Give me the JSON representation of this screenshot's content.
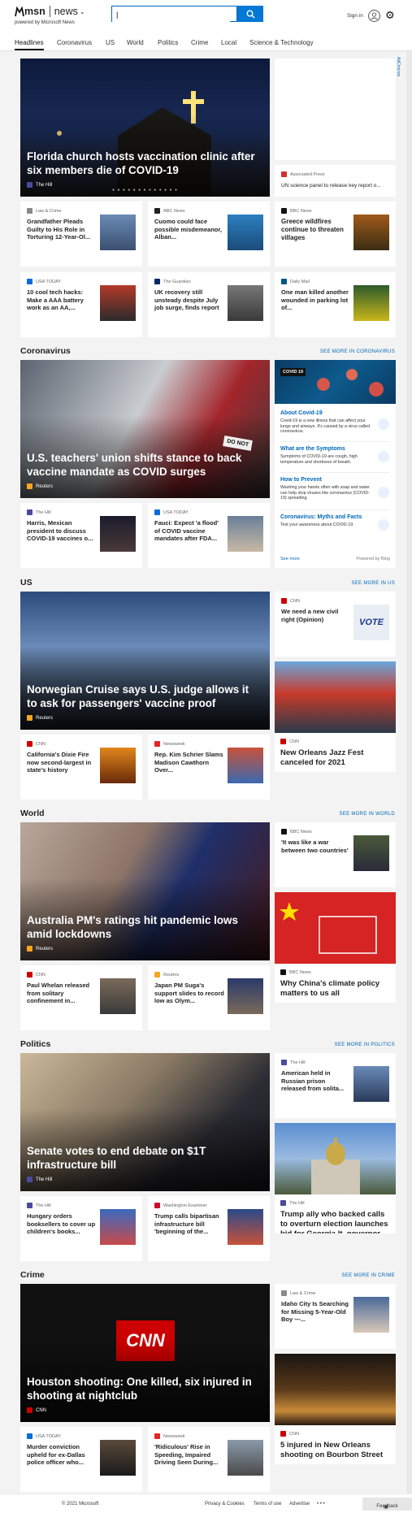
{
  "header": {
    "brand": "msn",
    "section": "news",
    "chevron": "⌄",
    "powered_by": "powered by Microsoft News",
    "search_value": "|",
    "signin": "Sign in"
  },
  "nav": [
    "Headlines",
    "Coronavirus",
    "US",
    "World",
    "Politics",
    "Crime",
    "Local",
    "Science & Technology"
  ],
  "ad_choices": "AdChoices",
  "headlines": {
    "hero": {
      "title": "Florida church hosts vaccination clinic after six members die of COVID-19",
      "source": "The Hill",
      "dots": "● ● ● ● ● ● ● ● ● ● ● ● ●"
    },
    "ap": {
      "source": "Associated Press",
      "title": "UN science panel to release key report o..."
    },
    "row1": [
      {
        "source": "Law & Crime",
        "title": "Grandfather Pleads Guilty to His Role in Torturing 12-Year-Ol..."
      },
      {
        "source": "ABC News",
        "title": "Cuomo could face possible misdemeanor, Alban..."
      },
      {
        "source": "BBC News",
        "title": "Greece wildfires continue to threaten villages"
      }
    ],
    "row2": [
      {
        "source": "USA TODAY",
        "title": "10 cool tech hacks: Make a AAA battery work as an AA,..."
      },
      {
        "source": "The Guardian",
        "title": "UK recovery still unsteady despite July job surge, finds report"
      },
      {
        "source": "Daily Mail",
        "title": "One man killed another wounded in parking lot of..."
      }
    ]
  },
  "coronavirus": {
    "heading": "Coronavirus",
    "see_more": "SEE MORE IN CORONAVIRUS",
    "hero": {
      "title": "U.S. teachers' union shifts stance to back vaccine mandate as COVID surges",
      "source": "Reuters",
      "sign": "DO NOT"
    },
    "cards": [
      {
        "source": "The Hill",
        "title": "Harris, Mexican president to discuss COVID-19 vaccines o..."
      },
      {
        "source": "USA TODAY",
        "title": "Fauci: Expect 'a flood' of COVID vaccine mandates after FDA..."
      }
    ],
    "panel": {
      "badge": "COVID 19",
      "topics": [
        {
          "heading": "About Covid-19",
          "desc": "Covid-19 is a new illness that can affect your lungs and airways. It's caused by a virus called coronavirus."
        },
        {
          "heading": "What are the Symptoms",
          "desc": "Symptoms of COVID-19 are cough, high temperature and shortness of breath."
        },
        {
          "heading": "How to Prevent",
          "desc": "Washing your hands often with soap and water can help stop viruses like coronavirus (COVID-19) spreading."
        },
        {
          "heading": "Coronavirus: Myths and Facts",
          "desc": "Test your awareness about COVID-19."
        }
      ],
      "see_more": "See more",
      "powered": "Powered by Bing"
    }
  },
  "us": {
    "heading": "US",
    "see_more": "SEE MORE IN US",
    "hero": {
      "title": "Norwegian Cruise says U.S. judge allows it to ask for passengers' vaccine proof",
      "source": "Reuters"
    },
    "side": {
      "source": "CNN",
      "title": "We need a new civil right (Opinion)",
      "thumb_text": "VOTE"
    },
    "tall": {
      "source": "CNN",
      "title": "New Orleans Jazz Fest canceled for 2021"
    },
    "cards": [
      {
        "source": "CNN",
        "title": "California's Dixie Fire now second-largest in state's history"
      },
      {
        "source": "Newsweek",
        "title": "Rep. Kim Schrier Slams Madison Cawthorn Over..."
      }
    ]
  },
  "world": {
    "heading": "World",
    "see_more": "SEE MORE IN WORLD",
    "hero": {
      "title": "Australia PM's ratings hit pandemic lows amid lockdowns",
      "source": "Reuters"
    },
    "side": {
      "source": "BBC News",
      "title": "'It was like a war between two countries'"
    },
    "tall": {
      "source": "BBC News",
      "title": "Why China's climate policy matters to us all"
    },
    "cards": [
      {
        "source": "CNN",
        "title": "Paul Whelan released from solitary confinement in..."
      },
      {
        "source": "Reuters",
        "title": "Japan PM Suga's support slides to record low as Olym..."
      }
    ]
  },
  "politics": {
    "heading": "Politics",
    "see_more": "SEE MORE IN POLITICS",
    "hero": {
      "title": "Senate votes to end debate on $1T infrastructure bill",
      "source": "The Hill"
    },
    "side": {
      "source": "The Hill",
      "title": "American held in Russian prison released from solita..."
    },
    "tall": {
      "source": "The Hill",
      "title": "Trump ally who backed calls to overturn election launches bid for Georgia lt. governor"
    },
    "cards": [
      {
        "source": "The Hill",
        "title": "Hungary orders booksellers to cover up children's books..."
      },
      {
        "source": "Washington Examiner",
        "title": "Trump calls bipartisan infrastructure bill 'beginning of the..."
      }
    ]
  },
  "crime": {
    "heading": "Crime",
    "see_more": "SEE MORE IN CRIME",
    "hero": {
      "title": "Houston shooting: One killed, six injured in shooting at nightclub",
      "source": "CNN",
      "logo": "CNN"
    },
    "side": {
      "source": "Law & Crime",
      "title": "Idaho City Is Searching for Missing 5-Year-Old Boy —..."
    },
    "tall": {
      "source": "CNN",
      "title": "5 injured in New Orleans shooting on Bourbon Street"
    },
    "cards": [
      {
        "source": "USA TODAY",
        "title": "Murder conviction upheld for ex-Dallas police officer who..."
      },
      {
        "source": "Newsweek",
        "title": "'Ridiculous' Rise in Speeding, Impaired Driving Seen During..."
      }
    ]
  },
  "footer": {
    "copyright": "© 2021 Microsoft",
    "links": [
      "Privacy & Cookies",
      "Terms of use",
      "Advertise",
      "• • •"
    ],
    "feedback": "Feedback"
  },
  "colors": {
    "accent": "#0078d4",
    "link": "#0067b8",
    "background": "#f3f3f3"
  }
}
